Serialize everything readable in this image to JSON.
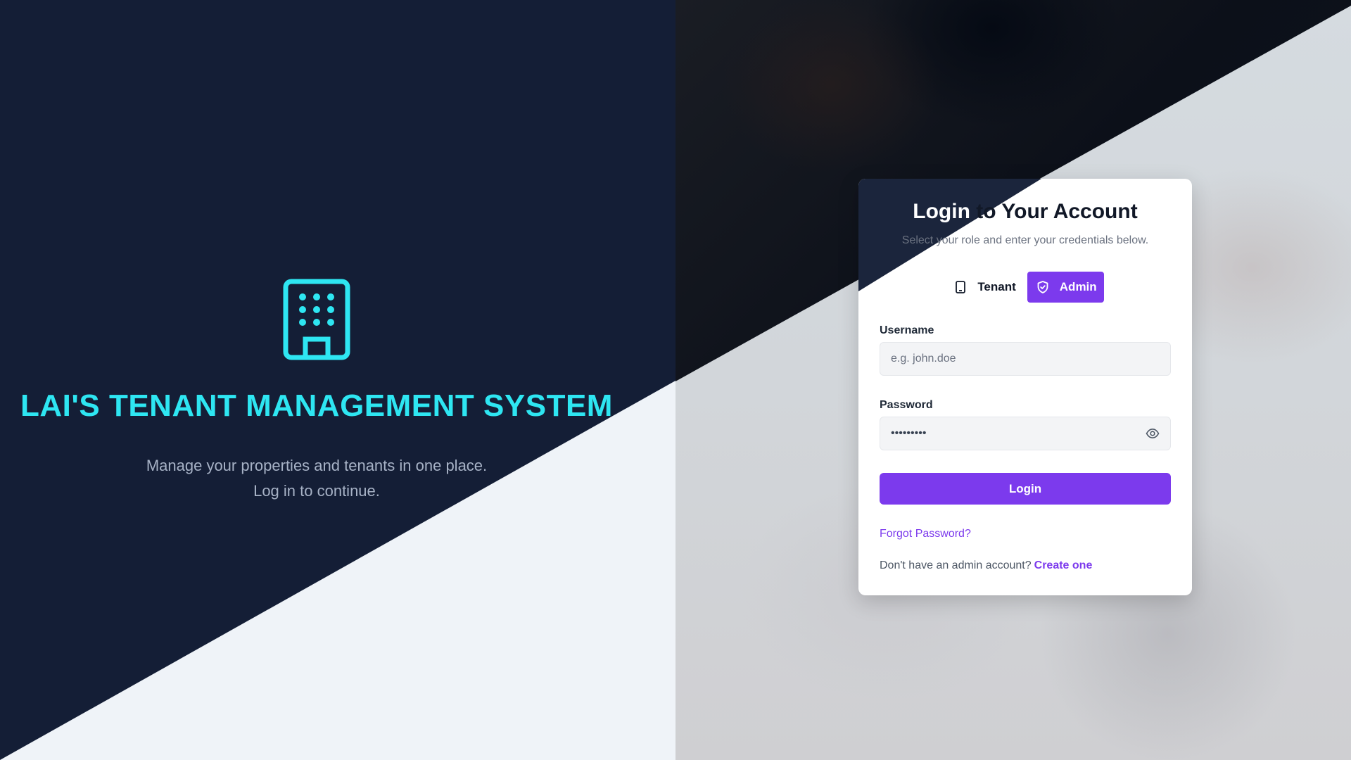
{
  "brand": {
    "icon": "building-icon",
    "title": "LAI'S TENANT MANAGEMENT SYSTEM",
    "subtitle_line1": "Manage your properties and tenants in one place.",
    "subtitle_line2": "Log in to continue.",
    "accent_color": "#2ee6f2"
  },
  "login": {
    "title_part1": "Login",
    "title_part2": " to Your Account",
    "subtitle": "Select your role and enter your credentials below.",
    "roles": [
      {
        "label": "Tenant",
        "icon": "tablet-icon",
        "active": false
      },
      {
        "label": "Admin",
        "icon": "shield-check-icon",
        "active": true
      }
    ],
    "username_label": "Username",
    "username_placeholder": "e.g. john.doe",
    "username_value": "",
    "password_label": "Password",
    "password_value": "password1",
    "password_toggle_icon": "eye-icon",
    "submit_label": "Login",
    "forgot_label": "Forgot Password?",
    "signup_prompt": "Don't have an admin account?",
    "signup_link": "Create one",
    "primary_color": "#7c3aed"
  }
}
